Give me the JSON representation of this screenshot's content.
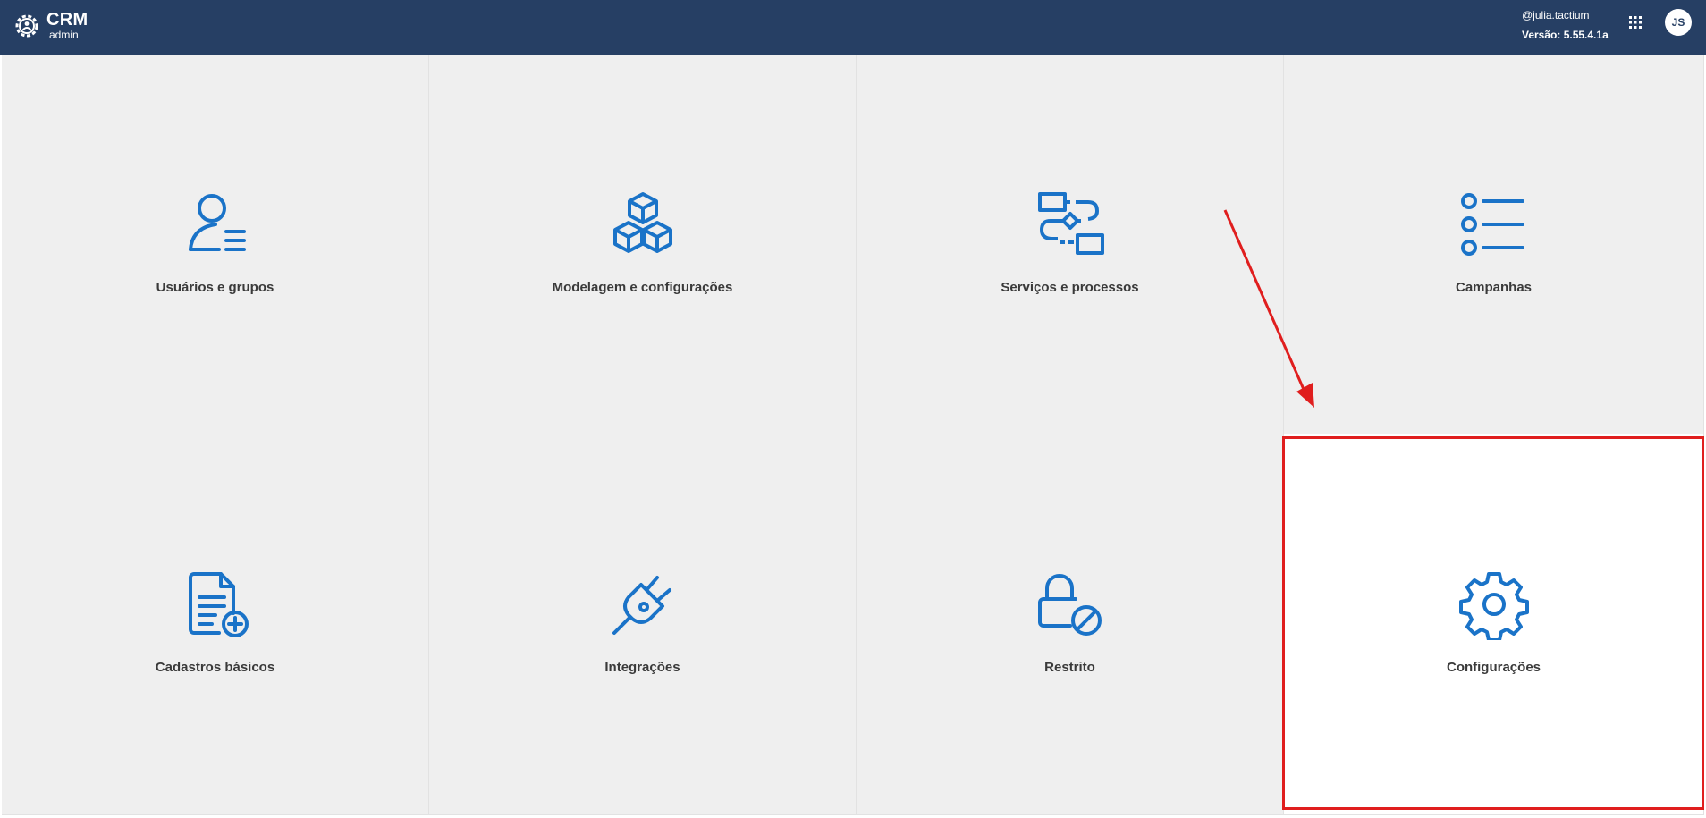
{
  "header": {
    "brand_name": "CRM",
    "brand_sub": "admin",
    "user_handle": "@julia.tactium",
    "version": "Versão: 5.55.4.1a",
    "avatar_initials": "JS",
    "background": "#263f64"
  },
  "tiles": [
    {
      "label": "Usuários e grupos",
      "icon": "user-list-icon"
    },
    {
      "label": "Modelagem e configurações",
      "icon": "cubes-icon"
    },
    {
      "label": "Serviços e processos",
      "icon": "workflow-icon"
    },
    {
      "label": "Campanhas",
      "icon": "list-icon"
    },
    {
      "label": "Cadastros básicos",
      "icon": "document-add-icon"
    },
    {
      "label": "Integrações",
      "icon": "plug-icon"
    },
    {
      "label": "Restrito",
      "icon": "lock-blocked-icon"
    },
    {
      "label": "Configurações",
      "icon": "gear-icon"
    }
  ],
  "colors": {
    "icon": "#1a73c8",
    "tile_bg": "#efefef",
    "selected_bg": "#ffffff",
    "annotation": "#e01e1e"
  }
}
